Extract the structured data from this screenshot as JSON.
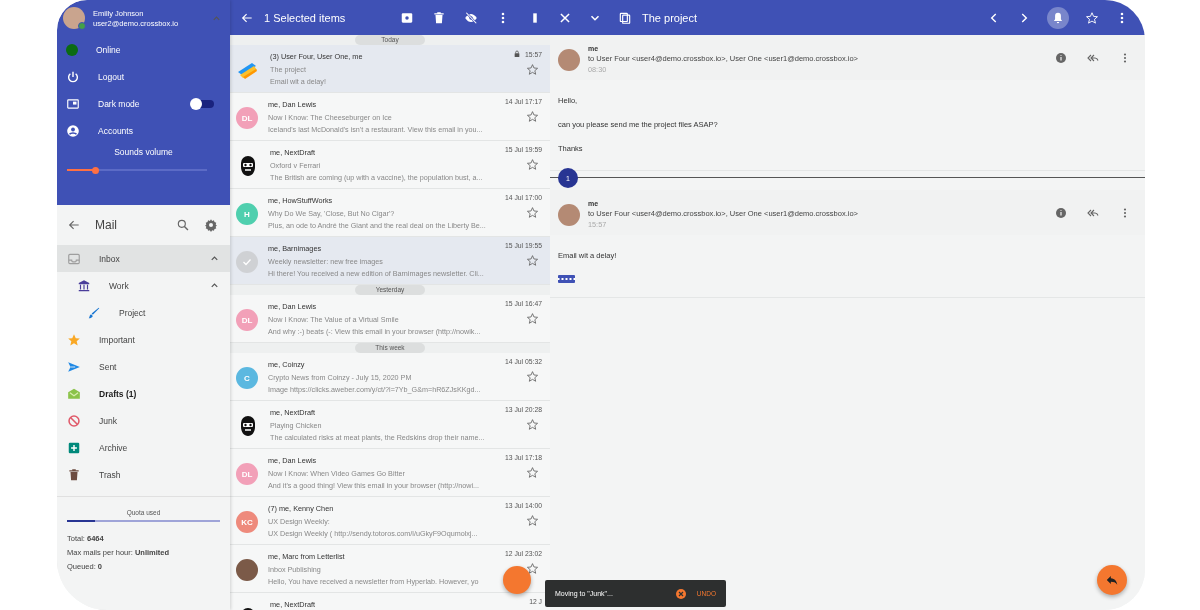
{
  "account": {
    "name": "Emilly Johnson",
    "email": "user2@demo.crossbox.io",
    "menu": [
      {
        "kind": "status",
        "label": "Online"
      },
      {
        "kind": "logout",
        "label": "Logout"
      },
      {
        "kind": "toggle",
        "label": "Dark mode",
        "on": false
      },
      {
        "kind": "accounts",
        "label": "Accounts"
      }
    ],
    "volume": {
      "label": "Sounds volume",
      "level": 0.2
    }
  },
  "mail": {
    "title": "Mail"
  },
  "folders": [
    {
      "kind": "inbox",
      "label": "Inbox",
      "selected": true,
      "unread": false,
      "expanded": true,
      "children": [
        {
          "kind": "bank",
          "label": "Work",
          "selected": false,
          "unread": false,
          "expanded": true,
          "children": [
            {
              "kind": "brush",
              "label": "Project",
              "selected": false,
              "unread": false
            }
          ]
        }
      ]
    },
    {
      "kind": "star",
      "label": "Important",
      "selected": false,
      "unread": false
    },
    {
      "kind": "send",
      "label": "Sent",
      "selected": false,
      "unread": false
    },
    {
      "kind": "drafts",
      "label": "Drafts (1)",
      "selected": false,
      "unread": true
    },
    {
      "kind": "junk",
      "label": "Junk",
      "selected": false,
      "unread": false
    },
    {
      "kind": "archive",
      "label": "Archive",
      "selected": false,
      "unread": false
    },
    {
      "kind": "trash",
      "label": "Trash",
      "selected": false,
      "unread": false
    }
  ],
  "quota": {
    "label": "Quota used",
    "level": 0.18,
    "stats": [
      {
        "label": "Total:",
        "value": "6464"
      },
      {
        "label": "Max mails per hour:",
        "value": "Unlimited"
      },
      {
        "label": "Queued:",
        "value": "0"
      }
    ]
  },
  "list_toolbar": {
    "title": "1 Selected items"
  },
  "groups": [
    {
      "label": "Today",
      "messages": [
        {
          "kind": "logo",
          "from": "(3) User Four, User One, me",
          "subject": "The project",
          "preview": "Email wit a delay!",
          "time": "15:57",
          "locked": true,
          "selected": true
        },
        {
          "kind": "initials",
          "initials": "DL",
          "color": "#f2a0b8",
          "from": "me, Dan Lewis",
          "subject": "Now I Know: The Cheeseburger on Ice",
          "preview": "Iceland's last McDonald's isn't a restaurant. View this email in you...",
          "time": "14 Jul 17:17",
          "locked": false,
          "selected": false
        },
        {
          "kind": "mascot",
          "from": "me, NextDraft",
          "subject": "Oxford v Ferrari",
          "preview": "The British are coming (up with a vaccine), the population bust, a...",
          "time": "15 Jul 19:59",
          "locked": false,
          "selected": false
        },
        {
          "kind": "initials",
          "initials": "H",
          "color": "#4fcfae",
          "from": "me, HowStuffWorks",
          "subject": "Why Do We Say, 'Close, But No Cigar'?",
          "preview": "Plus, an ode to André the Giant and the real deal on the Liberty Be...",
          "time": "14 Jul 17:00",
          "locked": false,
          "selected": false
        },
        {
          "kind": "check",
          "from": "me, Barnimages",
          "subject": "Weekly newsletter: new free images",
          "preview": "Hi there! You received a new edition of Barnimages newsletter. Cli...",
          "time": "15 Jul 19:55",
          "locked": false,
          "selected": true
        }
      ]
    },
    {
      "label": "Yesterday",
      "messages": [
        {
          "kind": "initials",
          "initials": "DL",
          "color": "#f2a0b8",
          "from": "me, Dan Lewis",
          "subject": "Now I Know: The Value of a Virtual Smile",
          "preview": "And why :-) beats (-: View this email in your browser (http://nowik...",
          "time": "15 Jul 16:47",
          "locked": false,
          "selected": false
        }
      ]
    },
    {
      "label": "This week",
      "messages": [
        {
          "kind": "initials",
          "initials": "C",
          "color": "#5bb8e0",
          "from": "me, Coinzy",
          "subject": "Crypto News from Coinzy - July 15, 2020 PM",
          "preview": "Image https://clicks.aweber.com/y/ct/?l=7Yb_G&m=hR6ZJsKKgd...",
          "time": "14 Jul 05:32",
          "locked": false,
          "selected": false
        },
        {
          "kind": "mascot",
          "from": "me, NextDraft",
          "subject": "Playing Chicken",
          "preview": "The calculated risks at meat plants, the Redskins drop their name...",
          "time": "13 Jul 20:28",
          "locked": false,
          "selected": false
        },
        {
          "kind": "initials",
          "initials": "DL",
          "color": "#f2a0b8",
          "from": "me, Dan Lewis",
          "subject": "Now I Know: When Video Games Go Bitter",
          "preview": "And it's a good thing! View this email in your browser (http://nowi...",
          "time": "13 Jul 17:18",
          "locked": false,
          "selected": false
        },
        {
          "kind": "initials",
          "initials": "KC",
          "color": "#ee8a7c",
          "from": "(7) me, Kenny Chen",
          "subject": "UX Design Weekly:",
          "preview": "UX Design Weekly ( http://sendy.totoros.com/l/uGkyF9Oqumolxj...",
          "time": "13 Jul 14:00",
          "locked": false,
          "selected": false
        },
        {
          "kind": "photo",
          "from": "me, Marc from Letterlist",
          "subject": "Inbox Publishing",
          "preview": "Hello, You have received a newsletter from Hyperlab. However, yo",
          "time": "12 Jul 23:02",
          "locked": false,
          "selected": false
        },
        {
          "kind": "mascot",
          "from": "me, NextDraft",
          "time": "12 J",
          "locked": false,
          "selected": false
        }
      ]
    }
  ],
  "reader_toolbar": {
    "title": "The project"
  },
  "thread": [
    {
      "from": "me",
      "to": "to User Four <user4@demo.crossbox.io>, User One <user1@demo.crossbox.io>",
      "time": "08:30",
      "body": [
        "Hello,",
        "can you please send me the project files ASAP?",
        "Thanks"
      ],
      "quoted": false
    },
    {
      "from": "me",
      "to": "to User Four <user4@demo.crossbox.io>, User One <user1@demo.crossbox.io>",
      "time": "15:57",
      "body": [
        "Email wit a delay!"
      ],
      "quoted": true
    }
  ],
  "thread_divider": "1",
  "snackbar": {
    "message": "Moving to \"Junk\"...",
    "action": "UNDO"
  }
}
